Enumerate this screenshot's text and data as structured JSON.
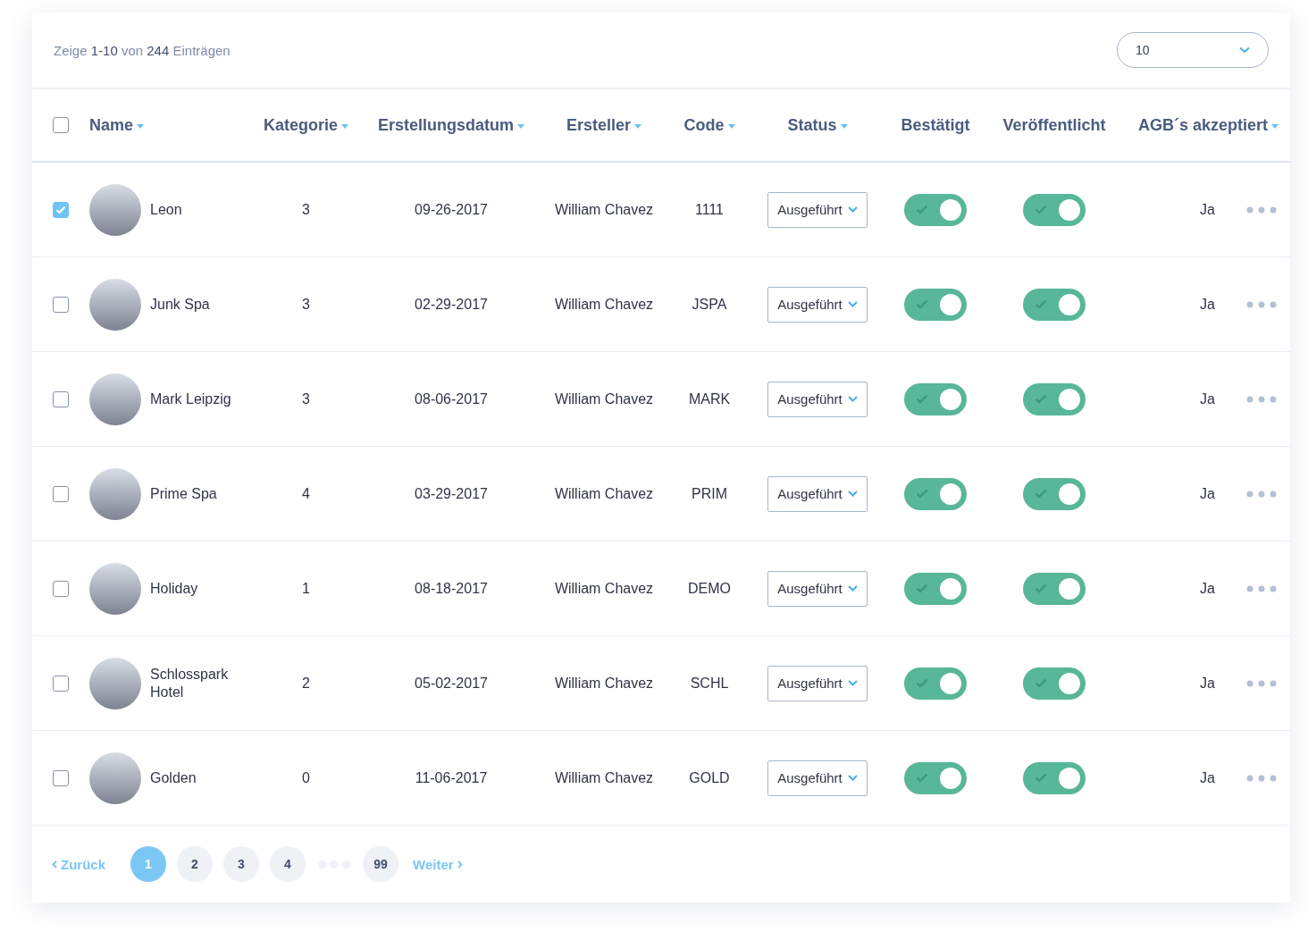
{
  "summary": {
    "prefix": "Zeige",
    "range": "1-10",
    "middle": "von",
    "total": "244",
    "suffix": "Einträgen"
  },
  "per_page": {
    "value": "10"
  },
  "select_all": {
    "checked": false
  },
  "columns": [
    {
      "label": "Name",
      "sortable": true
    },
    {
      "label": "Kategorie",
      "sortable": true
    },
    {
      "label": "Erstellungsdatum",
      "sortable": true
    },
    {
      "label": "Ersteller",
      "sortable": true
    },
    {
      "label": "Code",
      "sortable": true
    },
    {
      "label": "Status",
      "sortable": true
    },
    {
      "label": "Bestätigt",
      "sortable": false
    },
    {
      "label": "Veröffentlicht",
      "sortable": false
    },
    {
      "label": "AGB´s akzeptiert",
      "sortable": true
    }
  ],
  "rows": [
    {
      "checked": true,
      "name": "Leon",
      "kategorie": "3",
      "datum": "09-26-2017",
      "ersteller": "William Chavez",
      "code": "1111",
      "status": "Ausgeführt",
      "bestaetigt": true,
      "veroeffentlicht": true,
      "agb": "Ja"
    },
    {
      "checked": false,
      "name": "Junk Spa",
      "kategorie": "3",
      "datum": "02-29-2017",
      "ersteller": "William Chavez",
      "code": "JSPA",
      "status": "Ausgeführt",
      "bestaetigt": true,
      "veroeffentlicht": true,
      "agb": "Ja"
    },
    {
      "checked": false,
      "name": "Mark Leipzig",
      "kategorie": "3",
      "datum": "08-06-2017",
      "ersteller": "William Chavez",
      "code": "MARK",
      "status": "Ausgeführt",
      "bestaetigt": true,
      "veroeffentlicht": true,
      "agb": "Ja"
    },
    {
      "checked": false,
      "name": "Prime Spa",
      "kategorie": "4",
      "datum": "03-29-2017",
      "ersteller": "William Chavez",
      "code": "PRIM",
      "status": "Ausgeführt",
      "bestaetigt": true,
      "veroeffentlicht": true,
      "agb": "Ja"
    },
    {
      "checked": false,
      "name": "Holiday",
      "kategorie": "1",
      "datum": "08-18-2017",
      "ersteller": "William Chavez",
      "code": "DEMO",
      "status": "Ausgeführt",
      "bestaetigt": true,
      "veroeffentlicht": true,
      "agb": "Ja"
    },
    {
      "checked": false,
      "name": "Schlosspark Hotel",
      "kategorie": "2",
      "datum": "05-02-2017",
      "ersteller": "William Chavez",
      "code": "SCHL",
      "status": "Ausgeführt",
      "bestaetigt": true,
      "veroeffentlicht": true,
      "agb": "Ja"
    },
    {
      "checked": false,
      "name": "Golden",
      "kategorie": "0",
      "datum": "11-06-2017",
      "ersteller": "William Chavez",
      "code": "GOLD",
      "status": "Ausgeführt",
      "bestaetigt": true,
      "veroeffentlicht": true,
      "agb": "Ja"
    }
  ],
  "pagination": {
    "prev": "Zurück",
    "next": "Weiter",
    "pages": [
      {
        "kind": "page",
        "label": "1",
        "selected": true
      },
      {
        "kind": "page",
        "label": "2",
        "selected": false
      },
      {
        "kind": "page",
        "label": "3",
        "selected": false
      },
      {
        "kind": "page",
        "label": "4",
        "selected": false
      },
      {
        "kind": "gap"
      },
      {
        "kind": "page",
        "label": "99",
        "selected": false
      }
    ]
  }
}
